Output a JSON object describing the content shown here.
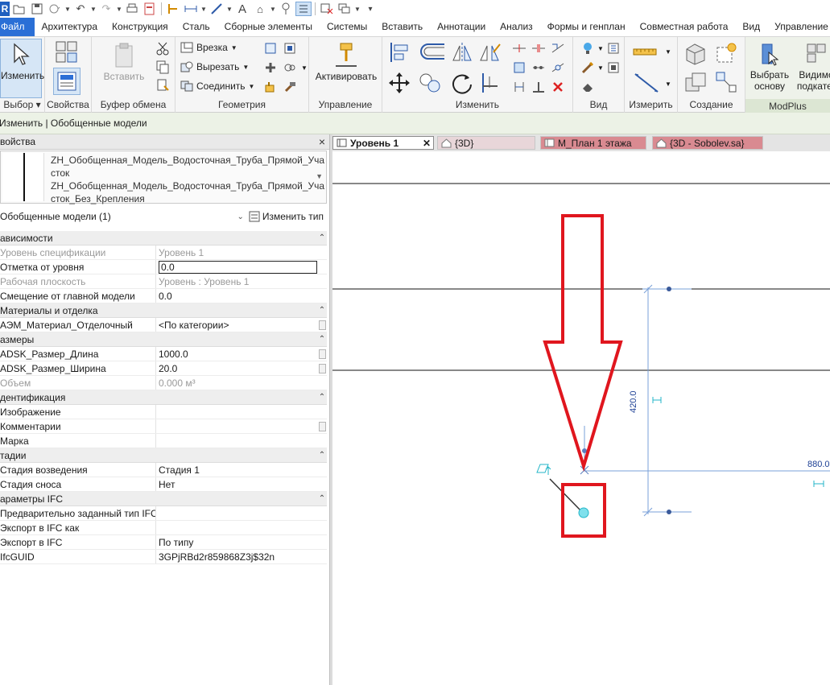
{
  "qat": {
    "app_letter": "R",
    "icons": [
      "open-icon",
      "save-icon",
      "sync-icon",
      "undo-icon",
      "redo-icon",
      "print-icon",
      "export-icon",
      "measure-icon",
      "dimension-icon",
      "tag-icon",
      "text-icon",
      "home-icon",
      "view-icon",
      "thin-lines-icon",
      "close-hidden-icon",
      "switch-windows-icon",
      "customize-icon"
    ]
  },
  "tabs": [
    {
      "label": "Файл",
      "active": true
    },
    {
      "label": "Архитектура"
    },
    {
      "label": "Конструкция"
    },
    {
      "label": "Сталь"
    },
    {
      "label": "Сборные элементы"
    },
    {
      "label": "Системы"
    },
    {
      "label": "Вставить"
    },
    {
      "label": "Аннотации"
    },
    {
      "label": "Анализ"
    },
    {
      "label": "Формы и генплан"
    },
    {
      "label": "Совместная работа"
    },
    {
      "label": "Вид"
    },
    {
      "label": "Управление"
    }
  ],
  "ribbon": {
    "select_panel": {
      "button": "Изменить",
      "label": "Выбор"
    },
    "properties_panel": {
      "label": "Свойства"
    },
    "clipboard_panel": {
      "paste": "Вставить",
      "label": "Буфер обмена"
    },
    "geometry_panel": {
      "cope": "Врезка",
      "cut": "Вырезать",
      "join": "Соединить",
      "label": "Геометрия"
    },
    "control_panel": {
      "button": "Активировать",
      "label": "Управление"
    },
    "modify_panel": {
      "label": "Изменить"
    },
    "view_panel": {
      "label": "Вид"
    },
    "measure_panel": {
      "label": "Измерить"
    },
    "create_panel": {
      "label": "Создание"
    },
    "modplus_panel": {
      "pick_base": "Выбрать основу",
      "visible_sub": "Видимо подкатег",
      "label": "ModPlus"
    }
  },
  "context_bar": "Изменить | Обобщенные модели",
  "properties": {
    "title": "войства",
    "close": "×",
    "type_lines": [
      "ZH_Обобщенная_Модель_Водосточная_Труба_Прямой_Уча",
      "сток",
      "ZH_Обобщенная_Модель_Водосточная_Труба_Прямой_Уча",
      "сток_Без_Крепления"
    ],
    "instance_filter": "Обобщенные модели (1)",
    "edit_type": "Изменить тип",
    "rows": [
      {
        "type": "hdr",
        "k": "ависимости"
      },
      {
        "type": "dis",
        "k": "Уровень спецификации",
        "v": "Уровень 1"
      },
      {
        "type": "edit",
        "k": "Отметка от уровня",
        "v": "0.0"
      },
      {
        "type": "dis",
        "k": "Рабочая плоскость",
        "v": "Уровень : Уровень 1"
      },
      {
        "type": "row",
        "k": "Смещение от главной модели",
        "v": "0.0"
      },
      {
        "type": "hdr",
        "k": "Материалы и отделка"
      },
      {
        "type": "row",
        "k": "АЭМ_Материал_Отделочный",
        "v": "<По категории>",
        "btn": true
      },
      {
        "type": "hdr",
        "k": "азмеры"
      },
      {
        "type": "row",
        "k": "ADSK_Размер_Длина",
        "v": "1000.0",
        "btn": true
      },
      {
        "type": "row",
        "k": "ADSK_Размер_Ширина",
        "v": "20.0",
        "btn": true
      },
      {
        "type": "dis",
        "k": "Объем",
        "v": "0.000 м³"
      },
      {
        "type": "hdr",
        "k": "дентификация"
      },
      {
        "type": "row",
        "k": "Изображение",
        "v": ""
      },
      {
        "type": "row",
        "k": "Комментарии",
        "v": "",
        "btn": true
      },
      {
        "type": "row",
        "k": "Марка",
        "v": ""
      },
      {
        "type": "hdr",
        "k": "тадии"
      },
      {
        "type": "row",
        "k": "Стадия возведения",
        "v": "Стадия 1"
      },
      {
        "type": "row",
        "k": "Стадия сноса",
        "v": "Нет"
      },
      {
        "type": "hdr",
        "k": "араметры IFC"
      },
      {
        "type": "row",
        "k": "Предварительно заданный тип IFC",
        "v": ""
      },
      {
        "type": "row",
        "k": "Экспорт в IFC как",
        "v": ""
      },
      {
        "type": "row",
        "k": "Экспорт в IFC",
        "v": "По типу"
      },
      {
        "type": "row",
        "k": "IfcGUID",
        "v": "3GPjRBd2r859868Z3j$32n"
      }
    ]
  },
  "view_tabs": [
    {
      "label": "Уровень 1",
      "active": true
    },
    {
      "label": "{3D}"
    },
    {
      "label": "М_План 1 этажа"
    },
    {
      "label": "{3D - Sobolev.sa}"
    }
  ],
  "view": {
    "dim_vertical": "420.0",
    "dim_horizontal": "880.0",
    "colors": {
      "annotation": "#1c3f94",
      "dimension": "#7aa0d8",
      "highlight": "#e0161e",
      "selected": "#23b6c8"
    }
  }
}
